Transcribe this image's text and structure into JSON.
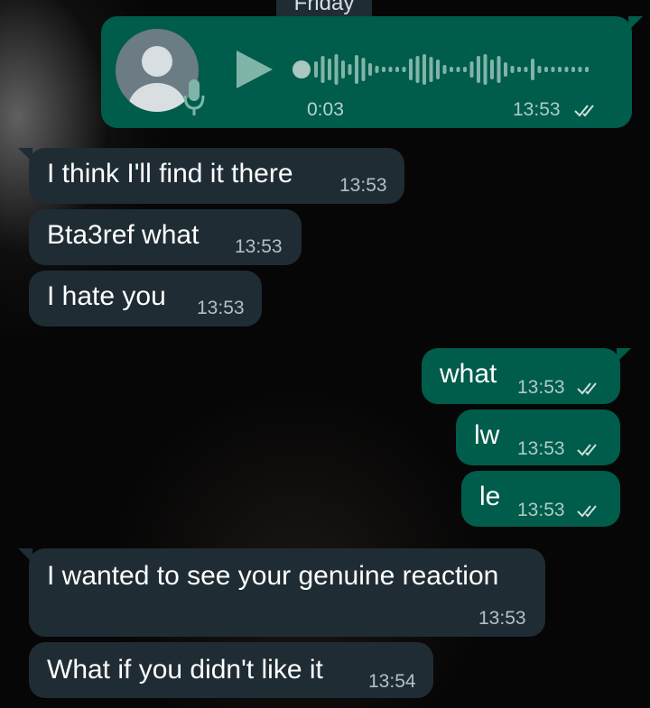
{
  "day_label": "Friday",
  "voice_note": {
    "duration": "0:03",
    "time": "13:53",
    "status": "read"
  },
  "messages": [
    {
      "text": "I think I'll find it there",
      "time": "13:53"
    },
    {
      "text": "Bta3ref what",
      "time": "13:53"
    },
    {
      "text": "I hate you",
      "time": "13:53"
    },
    {
      "text": "what",
      "time": "13:53",
      "status": "read"
    },
    {
      "text": "lw",
      "time": "13:53",
      "status": "read"
    },
    {
      "text": "le",
      "time": "13:53",
      "status": "read"
    },
    {
      "text": "I wanted to see your genuine reaction",
      "time": "13:53"
    },
    {
      "text": "What if you didn't like it",
      "time": "13:54"
    }
  ],
  "colors": {
    "incoming": "#1f2c34",
    "outgoing": "#005c4b",
    "read_ticks": "#d0e0dc"
  }
}
